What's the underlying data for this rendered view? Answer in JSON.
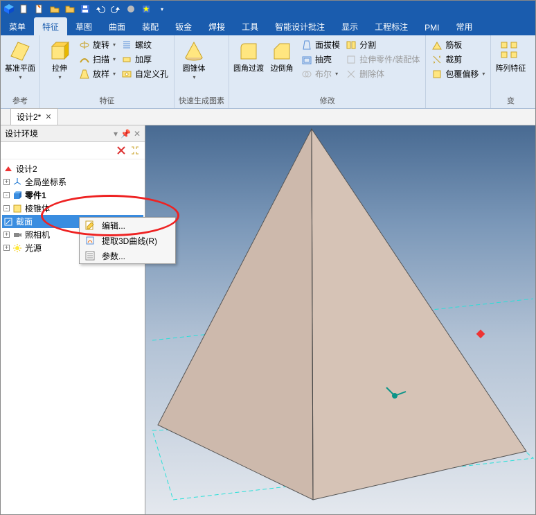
{
  "quickAccess": [
    "app",
    "new",
    "save",
    "folder-open",
    "folder",
    "disk",
    "undo",
    "redo",
    "render",
    "star",
    "dropdown"
  ],
  "tabs": [
    "菜单",
    "特征",
    "草图",
    "曲面",
    "装配",
    "钣金",
    "焊接",
    "工具",
    "智能设计批注",
    "显示",
    "工程标注",
    "PMI",
    "常用"
  ],
  "activeTab": 1,
  "ribbon": {
    "g1": {
      "label": "参考",
      "big": [
        {
          "t": "基准平面"
        }
      ]
    },
    "g2": {
      "label": "特征",
      "big": [
        {
          "t": "拉伸"
        }
      ],
      "rows": [
        [
          "旋转",
          "螺纹"
        ],
        [
          "扫描",
          "加厚"
        ],
        [
          "放样",
          "自定义孔"
        ]
      ]
    },
    "g3": {
      "label": "快速生成图素",
      "big": [
        {
          "t": "圆锥体"
        }
      ]
    },
    "g4": {
      "label": "修改",
      "big": [
        {
          "t": "圆角过渡"
        },
        {
          "t": "边倒角"
        }
      ],
      "rows": [
        [
          "面拔模",
          "分割"
        ],
        [
          "抽壳",
          "拉伸零件/装配体"
        ],
        [
          "布尔",
          "删除体"
        ]
      ]
    },
    "g5": {
      "label": "",
      "rows": [
        [
          "筋板"
        ],
        [
          "裁剪"
        ],
        [
          "包覆偏移"
        ]
      ]
    },
    "g6": {
      "label": "变",
      "big": [
        {
          "t": "阵列特征"
        }
      ]
    }
  },
  "docTab": "设计2*",
  "panel": {
    "title": "设计环境",
    "tree": {
      "root": "设计2",
      "items": [
        {
          "t": "全局坐标系",
          "exp": "+",
          "icon": "axis"
        },
        {
          "t": "零件1",
          "exp": "-",
          "icon": "part",
          "bold": true
        },
        {
          "t": "棱锥体",
          "icon": "feature",
          "ind": 2,
          "exp": "-"
        },
        {
          "t": "截面",
          "icon": "sketch",
          "ind": 3,
          "sel": true
        },
        {
          "t": "照相机",
          "exp": "+",
          "icon": "camera"
        },
        {
          "t": "光源",
          "exp": "+",
          "icon": "light"
        }
      ]
    }
  },
  "context": [
    {
      "t": "编辑...",
      "icon": "edit"
    },
    {
      "t": "提取3D曲线(R)",
      "icon": "extract"
    },
    {
      "t": "参数...",
      "icon": "params"
    }
  ]
}
